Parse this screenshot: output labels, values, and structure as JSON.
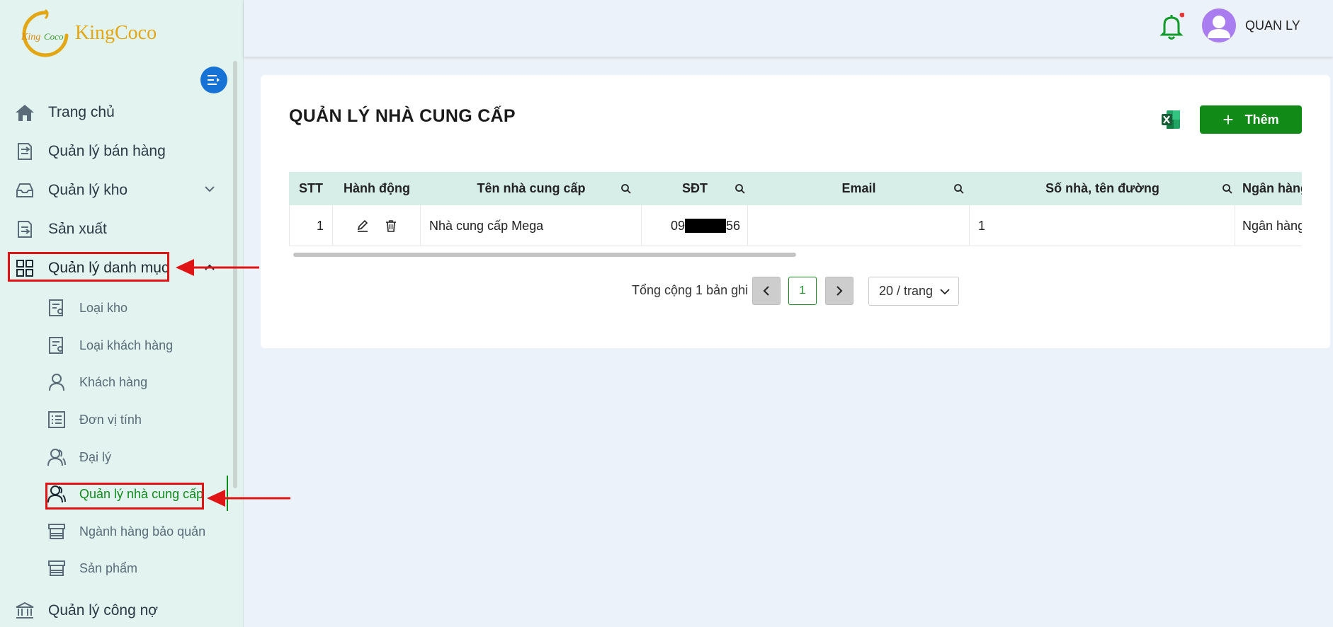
{
  "brand": {
    "name": "KingCoco",
    "mark_text": "KingCoco"
  },
  "sidebar": {
    "items": [
      {
        "label": "Trang chủ"
      },
      {
        "label": "Quản lý bán hàng"
      },
      {
        "label": "Quản lý kho"
      },
      {
        "label": "Sản xuất"
      },
      {
        "label": "Quản lý danh mục"
      },
      {
        "label": "Quản lý công nợ"
      }
    ],
    "subitems": [
      {
        "label": "Loại kho"
      },
      {
        "label": "Loại khách hàng"
      },
      {
        "label": "Khách hàng"
      },
      {
        "label": "Đơn vị tính"
      },
      {
        "label": "Đại lý"
      },
      {
        "label": "Quản lý nhà cung cấp"
      },
      {
        "label": "Ngành hàng bảo quản"
      },
      {
        "label": "Sản phẩm"
      }
    ]
  },
  "header": {
    "username": "QUAN LY"
  },
  "page": {
    "title": "QUẢN LÝ NHÀ CUNG CẤP",
    "add_label": "Thêm"
  },
  "table": {
    "columns": [
      "STT",
      "Hành động",
      "Tên nhà cung cấp",
      "SĐT",
      "Email",
      "Số nhà, tên đường",
      "Ngân hàng"
    ],
    "rows": [
      {
        "stt": "1",
        "name": "Nhà cung cấp Mega",
        "phone_prefix": "09",
        "phone_suffix": "56",
        "email": "",
        "address": "1",
        "bank": "Ngân hàng"
      }
    ]
  },
  "pagination": {
    "total_text": "Tổng cộng 1 bản ghi",
    "current_page": "1",
    "page_size": "20 / trang"
  },
  "colors": {
    "accent": "#118a18",
    "highlight": "#e01414",
    "sidebar_bg": "#e3f3ef"
  }
}
